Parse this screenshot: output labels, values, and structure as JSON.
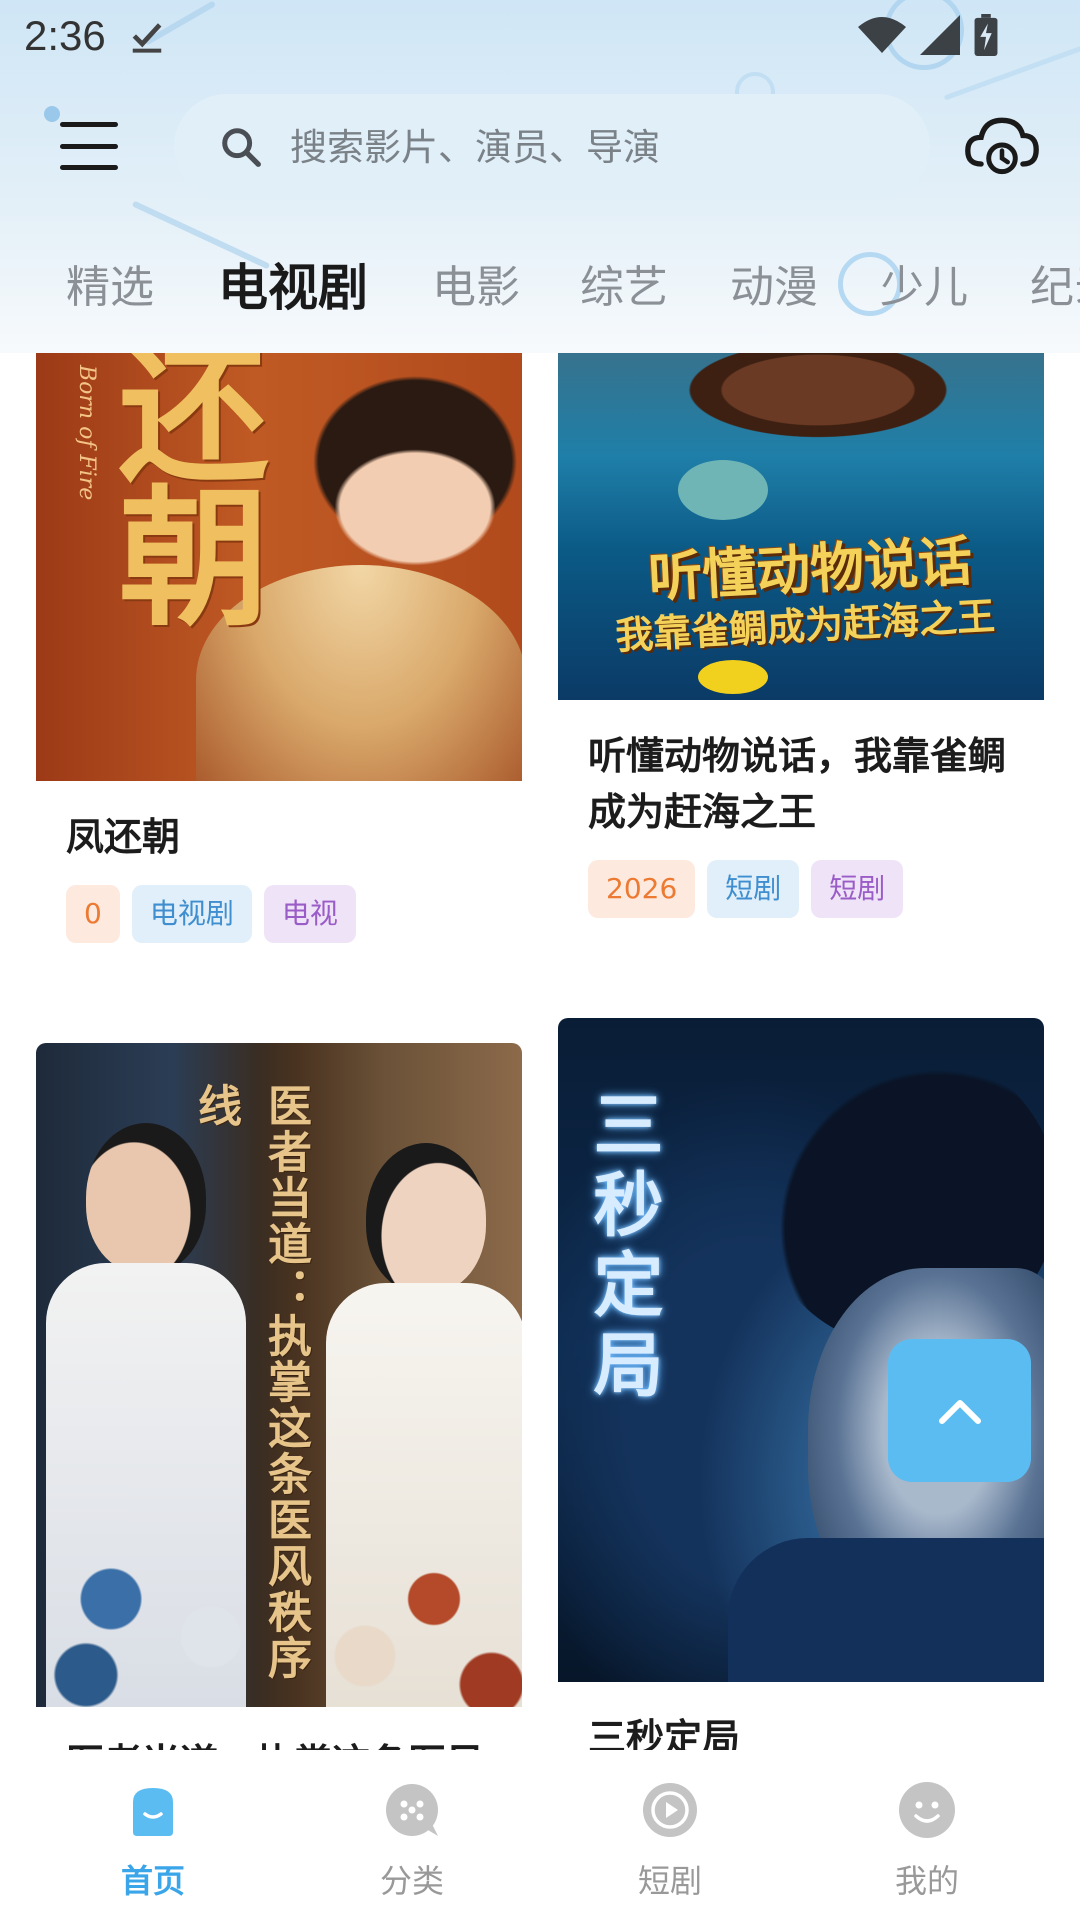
{
  "status_bar": {
    "time": "2:36"
  },
  "search": {
    "placeholder": "搜索影片、演员、导演"
  },
  "tabs": [
    {
      "label": "精选"
    },
    {
      "label": "电视剧"
    },
    {
      "label": "电影"
    },
    {
      "label": "综艺"
    },
    {
      "label": "动漫"
    },
    {
      "label": "少儿"
    },
    {
      "label": "纪录片"
    }
  ],
  "active_tab": "电视剧",
  "cards": [
    {
      "title": "凤还朝",
      "poster_text": "还朝",
      "poster_subtext": "Born of Fire",
      "tags": {
        "year": "0",
        "category": "电视剧",
        "type": "电视"
      }
    },
    {
      "title": "听懂动物说话，我靠雀鲷成为赶海之王",
      "poster_text": "听懂动物说话",
      "poster_subtext": "我靠雀鲷成为赶海之王",
      "tags": {
        "year": "2026",
        "category": "短剧",
        "type": "短剧"
      }
    },
    {
      "title": "医者当道：执掌这条医风秩序线",
      "poster_text": "医者当道：执掌这条医风秩序线"
    },
    {
      "title": "三秒定局",
      "poster_text": "三秒定局"
    }
  ],
  "bottom_nav": [
    {
      "label": "首页",
      "icon": "home-icon",
      "active": true
    },
    {
      "label": "分类",
      "icon": "category-icon",
      "active": false
    },
    {
      "label": "短剧",
      "icon": "play-icon",
      "active": false
    },
    {
      "label": "我的",
      "icon": "profile-icon",
      "active": false
    }
  ],
  "colors": {
    "accent": "#3aa5e8",
    "fab": "#5bbcf2",
    "tag_year_bg": "#fde9de",
    "tag_year_text": "#ec7a32",
    "tag_category_bg": "#e0eff9",
    "tag_category_text": "#3f8ed0",
    "tag_type_bg": "#efe3f8",
    "tag_type_text": "#9a5cc6"
  }
}
